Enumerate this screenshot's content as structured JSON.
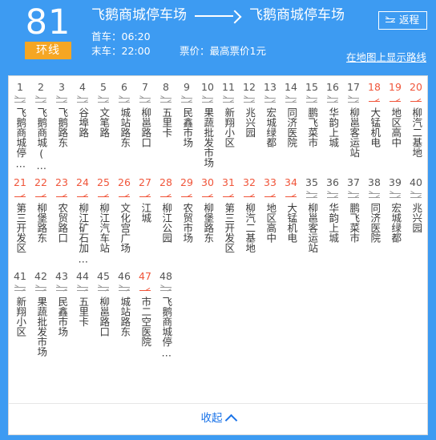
{
  "header": {
    "route_number": "81",
    "route_type": "环线",
    "origin": "飞鹅商城停车场",
    "destination": "飞鹅商城停车场",
    "first_bus_label": "首车：06:20",
    "last_bus_label": "末车：22:00",
    "fare_label": "票价：最高票价1元",
    "map_link": "在地图上显示路线",
    "return_button": "返程"
  },
  "footer": {
    "collapse_label": "收起"
  },
  "colors": {
    "brand_blue": "#3d9bf2",
    "badge_orange": "#f5a623",
    "one_way_red": "#f0553a",
    "two_way_gray": "#9a9a9a",
    "link_blue": "#1a73e8"
  },
  "stations": [
    {
      "num": "1",
      "name": "飞鹅商城停…",
      "direction": "two-way"
    },
    {
      "num": "2",
      "name": "飞鹅商城(…",
      "direction": "two-way"
    },
    {
      "num": "3",
      "name": "飞鹅路东",
      "direction": "two-way"
    },
    {
      "num": "4",
      "name": "谷埠路",
      "direction": "two-way"
    },
    {
      "num": "5",
      "name": "文笔路",
      "direction": "two-way"
    },
    {
      "num": "6",
      "name": "城站路东",
      "direction": "two-way"
    },
    {
      "num": "7",
      "name": "柳邕路口",
      "direction": "two-way"
    },
    {
      "num": "8",
      "name": "五里卡",
      "direction": "two-way"
    },
    {
      "num": "9",
      "name": "民鑫市场",
      "direction": "two-way"
    },
    {
      "num": "10",
      "name": "果蔬批发市场",
      "direction": "two-way"
    },
    {
      "num": "11",
      "name": "新翔小区",
      "direction": "two-way"
    },
    {
      "num": "12",
      "name": "兆兴园",
      "direction": "two-way"
    },
    {
      "num": "13",
      "name": "宏城绿都",
      "direction": "two-way"
    },
    {
      "num": "14",
      "name": "同济医院",
      "direction": "two-way"
    },
    {
      "num": "15",
      "name": "鹏飞菜市",
      "direction": "two-way"
    },
    {
      "num": "16",
      "name": "华韵上城",
      "direction": "two-way"
    },
    {
      "num": "17",
      "name": "柳邕客运站",
      "direction": "two-way"
    },
    {
      "num": "18",
      "name": "大锰机电",
      "direction": "one-way"
    },
    {
      "num": "19",
      "name": "地区高中",
      "direction": "one-way"
    },
    {
      "num": "20",
      "name": "柳汽二基地",
      "direction": "one-way"
    },
    {
      "num": "21",
      "name": "第三开发区",
      "direction": "one-way"
    },
    {
      "num": "22",
      "name": "柳堡路东",
      "direction": "one-way"
    },
    {
      "num": "23",
      "name": "农贸路口",
      "direction": "one-way"
    },
    {
      "num": "24",
      "name": "柳江矿石加…",
      "direction": "one-way"
    },
    {
      "num": "25",
      "name": "柳江汽车站",
      "direction": "one-way"
    },
    {
      "num": "26",
      "name": "文化宫广场",
      "direction": "one-way"
    },
    {
      "num": "27",
      "name": "江城",
      "direction": "one-way"
    },
    {
      "num": "28",
      "name": "柳江公园",
      "direction": "one-way"
    },
    {
      "num": "29",
      "name": "农贸市场",
      "direction": "one-way"
    },
    {
      "num": "30",
      "name": "柳堡路东",
      "direction": "one-way"
    },
    {
      "num": "31",
      "name": "第三开发区",
      "direction": "one-way"
    },
    {
      "num": "32",
      "name": "柳汽二基地",
      "direction": "one-way"
    },
    {
      "num": "33",
      "name": "地区高中",
      "direction": "one-way"
    },
    {
      "num": "34",
      "name": "大锰机电",
      "direction": "one-way"
    },
    {
      "num": "35",
      "name": "柳邕客运站",
      "direction": "two-way"
    },
    {
      "num": "36",
      "name": "华韵上城",
      "direction": "two-way"
    },
    {
      "num": "37",
      "name": "鹏飞菜市",
      "direction": "two-way"
    },
    {
      "num": "38",
      "name": "同济医院",
      "direction": "two-way"
    },
    {
      "num": "39",
      "name": "宏城绿都",
      "direction": "two-way"
    },
    {
      "num": "40",
      "name": "兆兴园",
      "direction": "two-way"
    },
    {
      "num": "41",
      "name": "新翔小区",
      "direction": "two-way"
    },
    {
      "num": "42",
      "name": "果蔬批发市场",
      "direction": "two-way"
    },
    {
      "num": "43",
      "name": "民鑫市场",
      "direction": "two-way"
    },
    {
      "num": "44",
      "name": "五里卡",
      "direction": "two-way"
    },
    {
      "num": "45",
      "name": "柳邕路口",
      "direction": "two-way"
    },
    {
      "num": "46",
      "name": "城站路东",
      "direction": "two-way"
    },
    {
      "num": "47",
      "name": "市二空医院",
      "direction": "one-way"
    },
    {
      "num": "48",
      "name": "飞鹅商城停…",
      "direction": "two-way"
    }
  ]
}
